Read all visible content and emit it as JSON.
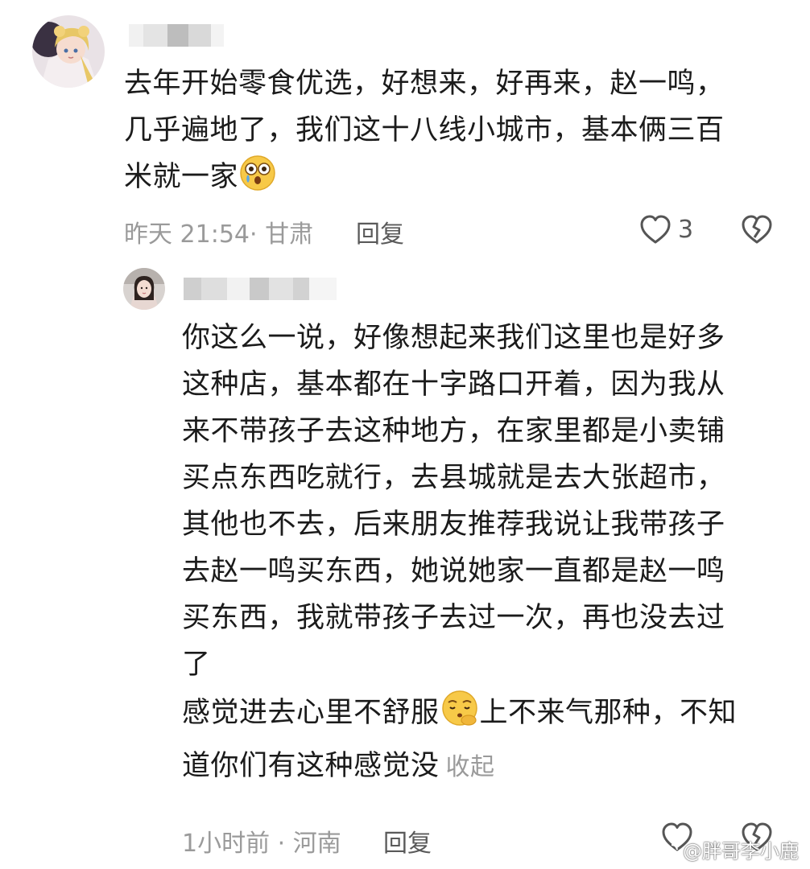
{
  "comment": {
    "lines": [
      "去年开始零食优选，好想来，好再来，赵一鸣，",
      "几乎遍地了，我们这十八线小城市，基本俩三百",
      "米就一家"
    ],
    "meta": "昨天 21:54· 甘肃",
    "reply_label": "回复",
    "like_count": "3",
    "emoji_icon": "crying-face-emoji",
    "like_icon": "heart-outline-icon",
    "dislike_icon": "broken-heart-icon"
  },
  "reply": {
    "lines": [
      "你这么一说，好像想起来我们这里也是好多",
      "这种店，基本都在十字路口开着，因为我从",
      "来不带孩子去这种地方，在家里都是小卖铺",
      "买点东西吃就行，去县城就是去大张超市，",
      "其他也不去，后来朋友推荐我说让我带孩子",
      "去赵一鸣买东西，她说她家一直都是赵一鸣",
      "买东西，我就带孩子去过一次，再也没去过",
      "了"
    ],
    "line9_before": "感觉进去心里不舒服",
    "line9_after": "上不来气那种，不知",
    "line10": "道你们有这种感觉没",
    "collapse_label": "收起",
    "meta": "1小时前 · 河南",
    "reply_label": "回复",
    "emoji_icon": "sighing-face-emoji"
  },
  "watermark": {
    "text": "@胖哥李小鹿",
    "icon": "weibo-logo-icon"
  },
  "colors": {
    "text": "#1b1b1b",
    "meta": "#9a9a9a",
    "reply": "#5a5a5a",
    "background": "#ffffff"
  }
}
